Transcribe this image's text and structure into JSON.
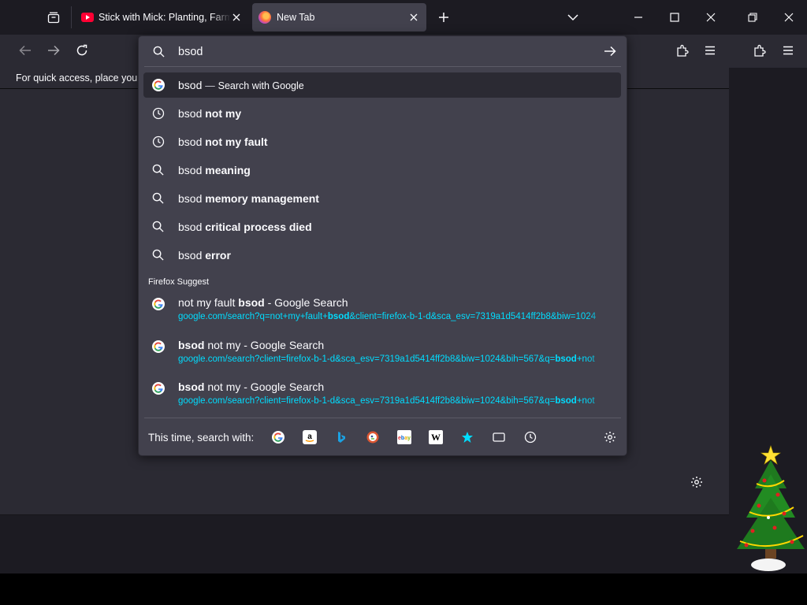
{
  "tabs": [
    {
      "title": "Stick with Mick: Planting, Farm A",
      "favicon": "youtube-icon",
      "active": false
    },
    {
      "title": "New Tab",
      "favicon": "firefox-icon",
      "active": true
    }
  ],
  "bookmarks_bar": {
    "text": "For quick access, place your b"
  },
  "urlbar": {
    "value": "bsod",
    "results": [
      {
        "type": "search-engine",
        "icon": "google-icon",
        "query": "bsod",
        "suffix": "—",
        "action": "Search with Google",
        "selected": true
      },
      {
        "type": "history",
        "icon": "clock-icon",
        "prefix": "bsod",
        "bold": "not my"
      },
      {
        "type": "history",
        "icon": "clock-icon",
        "prefix": "bsod",
        "bold": "not my fault"
      },
      {
        "type": "search",
        "icon": "search-icon",
        "prefix": "bsod",
        "bold": "meaning"
      },
      {
        "type": "search",
        "icon": "search-icon",
        "prefix": "bsod",
        "bold": "memory management"
      },
      {
        "type": "search",
        "icon": "search-icon",
        "prefix": "bsod",
        "bold": "critical process died"
      },
      {
        "type": "search",
        "icon": "search-icon",
        "prefix": "bsod",
        "bold": "error"
      }
    ],
    "suggest_label": "Firefox Suggest",
    "suggest": [
      {
        "title_pre": "not my fault ",
        "title_bold": "bsod",
        "title_post": " - Google Search",
        "url_pre": "google.com/search?q=not+my+fault+",
        "url_bold": "bsod",
        "url_post": "&client=firefox-b-1-d&sca_esv=7319a1d5414ff2b8&biw=1024"
      },
      {
        "title_pre": "",
        "title_bold": "bsod",
        "title_post": " not my - Google Search",
        "url_pre": "google.com/search?client=firefox-b-1-d&sca_esv=7319a1d5414ff2b8&biw=1024&bih=567&q=",
        "url_bold": "bsod",
        "url_post": "+not"
      },
      {
        "title_pre": "",
        "title_bold": "bsod",
        "title_post": " not my - Google Search",
        "url_pre": "google.com/search?client=firefox-b-1-d&sca_esv=7319a1d5414ff2b8&biw=1024&bih=567&q=",
        "url_bold": "bsod",
        "url_post": "+not"
      }
    ],
    "footer_label": "This time, search with:",
    "engines": [
      "google-icon",
      "amazon-icon",
      "bing-icon",
      "duckduckgo-icon",
      "ebay-icon",
      "wikipedia-icon",
      "bookmarks-star-icon",
      "tabs-icon",
      "history-icon"
    ]
  },
  "colors": {
    "accent": "#00ddff",
    "bg": "#1c1b22",
    "panel": "#42414d"
  }
}
